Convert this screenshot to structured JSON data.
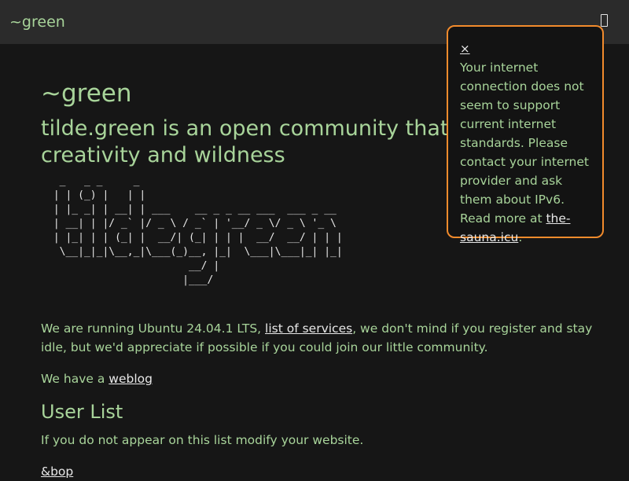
{
  "header": {
    "brand": "~green"
  },
  "main": {
    "title": "~green",
    "tagline_line1": "tilde.green is an open community that t",
    "tagline_line2": "creativity and wildness",
    "ascii_art": "  _   _ _     _\n | | (_) |   | |\n | |_ _| | __| | ___    __ _ _ __ ___  ___ _ __\n | __| | |/ _` |/ _ \\ / _` | '__/ _ \\/ _ \\ '_ \\\n | |_| | | (_| |  __/| (_| | | |  __/  __/ | | |\n  \\__|_|_|\\__,_|\\___(_)__, |_|  \\___|\\___|_| |_|\n                       __/ |\n                      |___/",
    "intro_before": "We are running Ubuntu 24.04.1 LTS, ",
    "services_link": "list of services",
    "intro_after": ", we don't mind if you register and stay idle, but we'd appreciate if possible if you could join our little community.",
    "weblog_before": "We have a ",
    "weblog_link": "weblog",
    "user_list_heading": "User List",
    "user_list_note": "If you do not appear on this list modify your website.",
    "first_user": "&bop"
  },
  "popup": {
    "close": "×",
    "text": "Your internet connection does not seem to support current internet standards. Please contact your internet provider and ask them about IPv6. Read more at ",
    "link": "the-sauna.icu",
    "after": "."
  },
  "colors": {
    "accent_green": "#a8d49a",
    "popup_border": "#f28b2c",
    "background": "#161616",
    "header_bg": "#2b2b2b"
  },
  "icons": {
    "menu": "menu-icon"
  }
}
